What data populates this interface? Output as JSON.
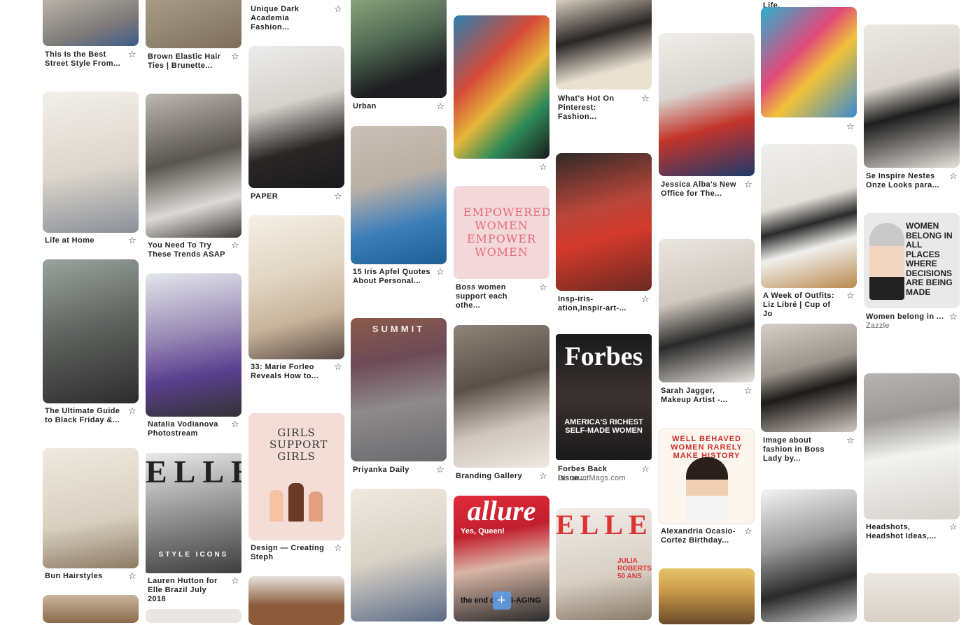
{
  "pins": {
    "c1p1": {
      "title": "This Is the Best Street Style From...",
      "icon": "image"
    },
    "c1p2": {
      "title": "Life at Home"
    },
    "c1p3": {
      "title": "The Ultimate Guide to Black Friday &..."
    },
    "c1p4": {
      "title": "Bun Hairstyles"
    },
    "c2p1": {
      "title": "Brown Elastic Hair Ties | Brunette..."
    },
    "c2p2": {
      "title": "You Need To Try These Trends ASAP"
    },
    "c2p3": {
      "title": "Natalia Vodianova Photostream"
    },
    "c2p4": {
      "title": "Lauren Hutton for Elle Brazil July 2018",
      "mag_title": "ELLE",
      "mag_tag": "STYLE ICONS"
    },
    "c3p0": {
      "title": "Unique Dark Academia Fashion..."
    },
    "c3p1": {
      "title": "PAPER"
    },
    "c3p2": {
      "title": "33: Marie Forleo Reveals How to..."
    },
    "c3p3": {
      "title": "Design — Creating Steph",
      "poster_text": "GIRLS SUPPORT GIRLS"
    },
    "c4p1": {
      "title": "Urban"
    },
    "c4p2": {
      "title": "15 Iris Apfel Quotes About Personal..."
    },
    "c4p3": {
      "title": "Priyanka Daily",
      "banner": "SUMMIT"
    },
    "c5p1": {
      "title": ""
    },
    "c5p2": {
      "title": "Boss women support each othe...",
      "poster_text": "EMPOWERED WOMEN EMPOWER WOMEN"
    },
    "c5p3": {
      "title": "Branding Gallery"
    },
    "c5p4": {
      "mag_title": "allure",
      "mag_tag": "Yes, Queen!",
      "mag_bottom": "the end of anti-AGING"
    },
    "c6p1": {
      "title": "What's Hot On Pinterest: Fashion..."
    },
    "c6p2": {
      "title": "Insp-iris-ation,Inspir-art-..."
    },
    "c6p3": {
      "title": "Forbes Back Issue...",
      "source": "DiscountMags.com",
      "mag_title": "Forbes",
      "mag_tag": "AMERICA'S RICHEST SELF-MADE WOMEN"
    },
    "c6p4": {
      "mag_title": "ELLE",
      "mag_tag": "JULIA ROBERTS 50 ANS"
    },
    "c7p1": {
      "title": "Jessica Alba's New Office for The..."
    },
    "c7p2": {
      "title": "Sarah Jagger, Makeup Artist -..."
    },
    "c7p3": {
      "title": "Alexandria Ocasio-Cortez Birthday...",
      "poster_text": "WELL BEHAVED WOMEN RARELY MAKE HISTORY"
    },
    "c8p0": {
      "title": "Life."
    },
    "c8p1": {
      "title": ""
    },
    "c8p2": {
      "title": "A Week of Outfits: Liz Libré | Cup of Jo"
    },
    "c8p3": {
      "title": "Image about fashion in Boss Lady by..."
    },
    "c9p1": {
      "title": "Se Inspire Nestes Onze Looks para..."
    },
    "c9p2": {
      "title": "Women belong in ...",
      "source": "Zazzle",
      "poster_text": "WOMEN BELONG IN ALL PLACES WHERE DECISIONS ARE BEING MADE"
    },
    "c9p3": {
      "title": "Headshots, Headshot Ideas,..."
    }
  },
  "icons": {
    "save": "star-outline-icon",
    "add": "plus-icon"
  },
  "colors": {
    "caption": "#222222",
    "source": "#666666",
    "accent_pink": "#e86a7c"
  }
}
